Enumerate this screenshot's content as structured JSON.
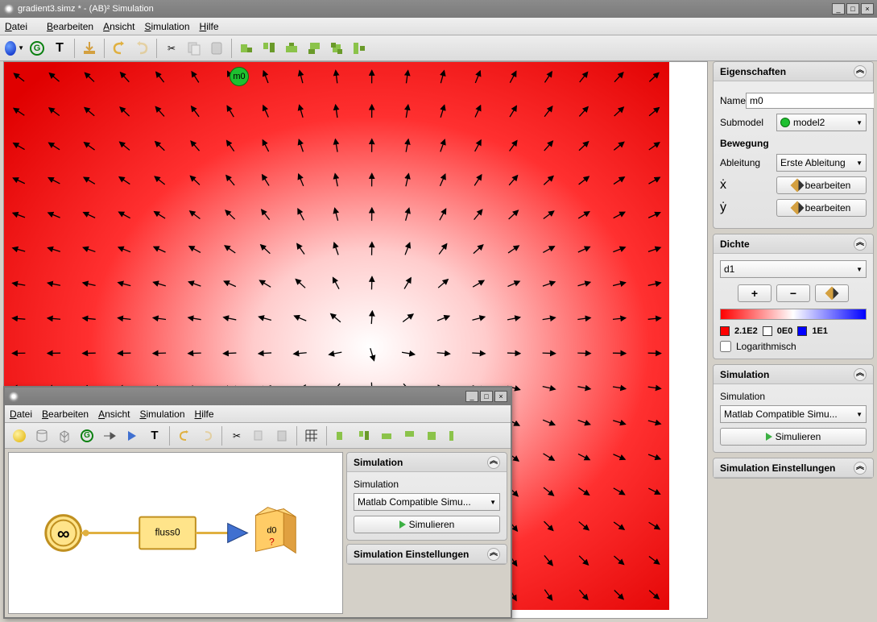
{
  "window": {
    "title": "gradient3.simz * - (AB)² Simulation"
  },
  "menu": {
    "datei": "Datei",
    "bearbeiten": "Bearbeiten",
    "ansicht": "Ansicht",
    "simulation": "Simulation",
    "hilfe": "Hilfe"
  },
  "canvas": {
    "badge": "m0"
  },
  "props": {
    "title": "Eigenschaften",
    "name_label": "Name",
    "name_value": "m0",
    "submodel_label": "Submodel",
    "submodel_value": "model2",
    "bewegung_label": "Bewegung",
    "ableitung_label": "Ableitung",
    "ableitung_value": "Erste Ableitung",
    "xdot": "ẋ",
    "ydot": "ẏ",
    "bearbeiten": "bearbeiten"
  },
  "dichte": {
    "title": "Dichte",
    "select": "d1",
    "plus": "+",
    "minus": "−",
    "legend_red": "2.1E2",
    "legend_white": "0E0",
    "legend_blue": "1E1",
    "log": "Logarithmisch"
  },
  "sim": {
    "title": "Simulation",
    "label": "Simulation",
    "engine": "Matlab Compatible Simu...",
    "run": "Simulieren",
    "settings_title": "Simulation Einstellungen"
  },
  "child": {
    "flow_label": "fluss0",
    "d0": "d0",
    "question": "?"
  }
}
